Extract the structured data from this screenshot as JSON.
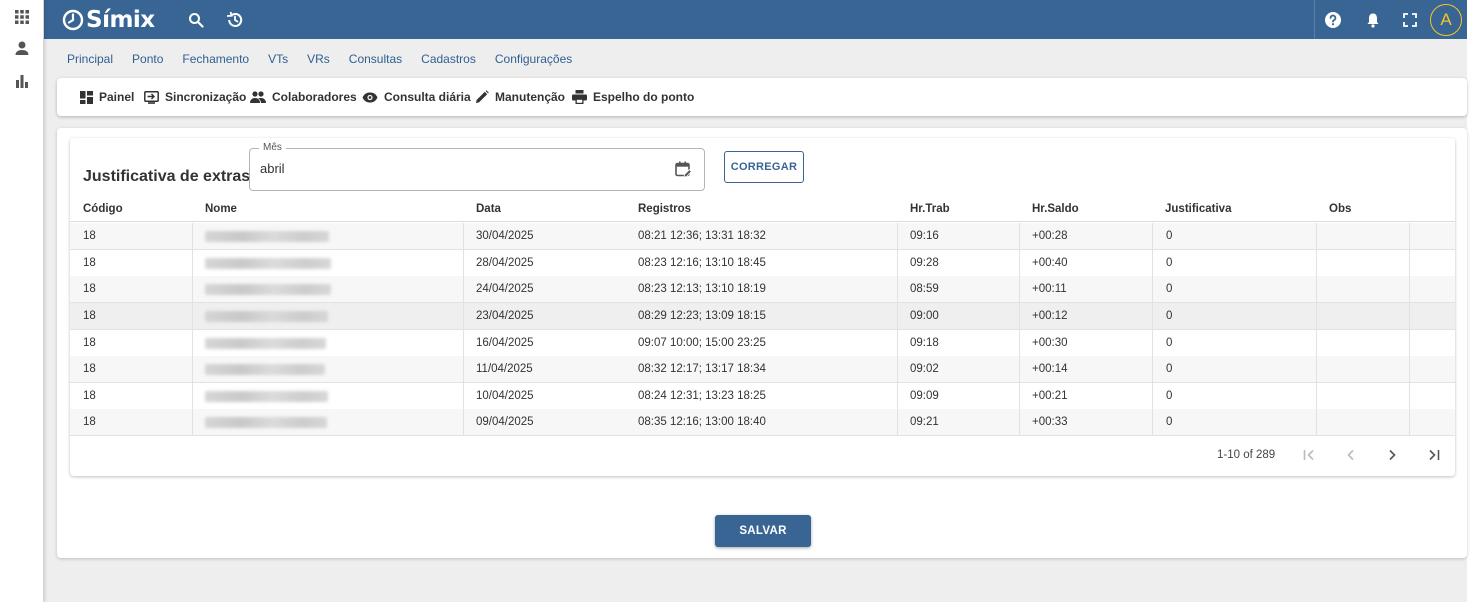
{
  "app": {
    "logo_text": "Símix"
  },
  "colors": {
    "primary": "#396594",
    "avatar_ring": "#f3c623"
  },
  "rail": [
    {
      "name": "apps-grid-icon"
    },
    {
      "name": "person-icon"
    },
    {
      "name": "bar-chart-icon"
    }
  ],
  "topbar": {
    "avatar_letter": "A"
  },
  "menu": [
    "Principal",
    "Ponto",
    "Fechamento",
    "VTs",
    "VRs",
    "Consultas",
    "Cadastros",
    "Configurações"
  ],
  "subbar": {
    "painel": "Painel",
    "sincronizacao": "Sincronização",
    "colaboradores": "Colaboradores",
    "consulta_diaria": "Consulta diária",
    "manutencao": "Manutenção",
    "espelho": "Espelho do ponto"
  },
  "page": {
    "title": "Justificativa de extras",
    "month_label": "Mês",
    "month_value": "abril",
    "reload_button": "CORREGAR",
    "save_button": "SALVAR"
  },
  "table": {
    "headers": {
      "codigo": "Código",
      "nome": "Nome",
      "data": "Data",
      "registros": "Registros",
      "hrtrab": "Hr.Trab",
      "hrsaldo": "Hr.Saldo",
      "justificativa": "Justificativa",
      "obs": "Obs"
    },
    "rows": [
      {
        "codigo": "18",
        "data": "30/04/2025",
        "registros": "08:21 12:36; 13:31 18:32",
        "hrtrab": "09:16",
        "hrsaldo": "+00:28",
        "justificativa": "0"
      },
      {
        "codigo": "18",
        "data": "28/04/2025",
        "registros": "08:23 12:16; 13:10 18:45",
        "hrtrab": "09:28",
        "hrsaldo": "+00:40",
        "justificativa": "0"
      },
      {
        "codigo": "18",
        "data": "24/04/2025",
        "registros": "08:23 12:13; 13:10 18:19",
        "hrtrab": "08:59",
        "hrsaldo": "+00:11",
        "justificativa": "0"
      },
      {
        "codigo": "18",
        "data": "23/04/2025",
        "registros": "08:29 12:23; 13:09 18:15",
        "hrtrab": "09:00",
        "hrsaldo": "+00:12",
        "justificativa": "0"
      },
      {
        "codigo": "18",
        "data": "16/04/2025",
        "registros": "09:07 10:00; 15:00 23:25",
        "hrtrab": "09:18",
        "hrsaldo": "+00:30",
        "justificativa": "0"
      },
      {
        "codigo": "18",
        "data": "11/04/2025",
        "registros": "08:32 12:17; 13:17 18:34",
        "hrtrab": "09:02",
        "hrsaldo": "+00:14",
        "justificativa": "0"
      },
      {
        "codigo": "18",
        "data": "10/04/2025",
        "registros": "08:24 12:31; 13:23 18:25",
        "hrtrab": "09:09",
        "hrsaldo": "+00:21",
        "justificativa": "0"
      },
      {
        "codigo": "18",
        "data": "09/04/2025",
        "registros": "08:35 12:16; 13:00 18:40",
        "hrtrab": "09:21",
        "hrsaldo": "+00:33",
        "justificativa": "0"
      }
    ],
    "pagination": "1-10 of 289"
  }
}
